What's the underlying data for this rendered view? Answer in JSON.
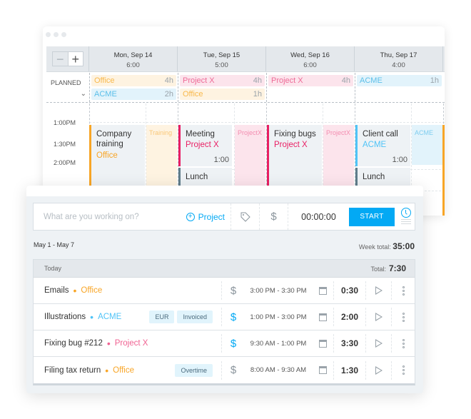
{
  "colors": {
    "accent": "#03a9f4",
    "office": "#f8a526",
    "acme": "#5bbfe9",
    "project_x": "#e91e63",
    "lunch": "#607d8b"
  },
  "calendar": {
    "zoom_out_label": "−",
    "zoom_in_label": "+",
    "planned_label": "PLANNED",
    "expand_icon": "chevron-down-icon",
    "days": [
      {
        "label": "Mon, Sep 14",
        "total": "6:00"
      },
      {
        "label": "Tue, Sep 15",
        "total": "5:00"
      },
      {
        "label": "Wed, Sep 16",
        "total": "6:00"
      },
      {
        "label": "Thu, Sep 17",
        "total": "4:00"
      }
    ],
    "planned": [
      [
        {
          "project": "Office",
          "hours": "4h"
        },
        {
          "project": "ACME",
          "hours": "2h"
        }
      ],
      [
        {
          "project": "Project X",
          "hours": "4h"
        },
        {
          "project": "Office",
          "hours": "1h"
        }
      ],
      [
        {
          "project": "Project X",
          "hours": "4h"
        }
      ],
      [
        {
          "project": "ACME",
          "hours": "1h"
        }
      ]
    ],
    "times": [
      "1:00PM",
      "1:30PM",
      "2:00PM"
    ],
    "events": [
      {
        "title": "Company training",
        "project": "Office",
        "ghost": "Training"
      },
      {
        "title": "Meeting",
        "project": "Project X",
        "duration": "1:00",
        "ghost": "ProjectX"
      },
      {
        "title": "Lunch"
      },
      {
        "title": "Fixing bugs",
        "project": "Project X",
        "ghost": "ProjectX"
      },
      {
        "title": "Client call",
        "project": "ACME",
        "duration": "1:00",
        "ghost": "ACME"
      },
      {
        "title": "Lunch"
      }
    ]
  },
  "tracker": {
    "description_placeholder": "What are you working on?",
    "project_button": "Project",
    "tag_icon": "tag-icon",
    "billable_icon": "dollar-icon",
    "timer": "00:00:00",
    "start_label": "START",
    "week_range": "May 1 - May 7",
    "week_total_label": "Week total:",
    "week_total": "35:00",
    "day_label": "Today",
    "day_total_label": "Total:",
    "day_total": "7:30",
    "entries": [
      {
        "description": "Emails",
        "project": "Office",
        "tags": [],
        "billable": false,
        "time_range": "3:00 PM - 3:30 PM",
        "duration": "0:30"
      },
      {
        "description": "Illustrations",
        "project": "ACME",
        "tags": [
          "EUR",
          "Invoiced"
        ],
        "billable": true,
        "time_range": "1:00 PM - 3:00 PM",
        "duration": "2:00"
      },
      {
        "description": "Fixing bug #212",
        "project": "Project X",
        "tags": [],
        "billable": true,
        "time_range": "9:30 AM - 1:00 PM",
        "duration": "3:30"
      },
      {
        "description": "Filing tax return",
        "project": "Office",
        "tags": [
          "Overtime"
        ],
        "billable": false,
        "time_range": "8:00 AM - 9:30 AM",
        "duration": "1:30"
      }
    ]
  }
}
